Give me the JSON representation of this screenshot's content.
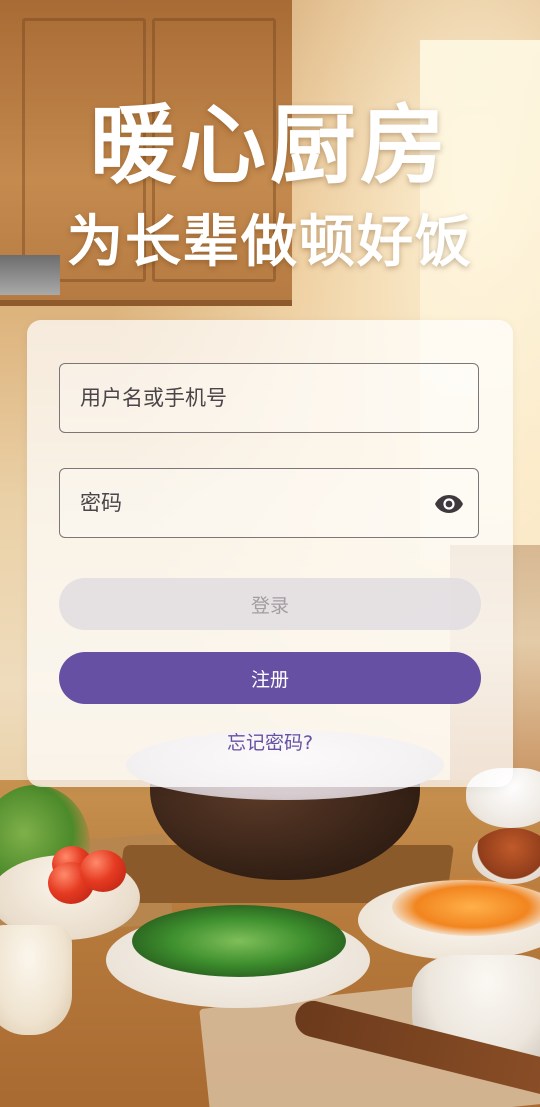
{
  "headline": {
    "title": "暖心厨房",
    "subtitle": "为长辈做顿好饭"
  },
  "login_form": {
    "username_placeholder": "用户名或手机号",
    "username_value": "",
    "password_placeholder": "密码",
    "password_value": "",
    "password_toggle_icon": "eye-icon",
    "login_button_label": "登录",
    "register_button_label": "注册",
    "forgot_password_label": "忘记密码?"
  },
  "colors": {
    "accent": "#6650a4",
    "login_disabled_bg": "#e1dce0",
    "login_disabled_text": "#a29da0"
  }
}
